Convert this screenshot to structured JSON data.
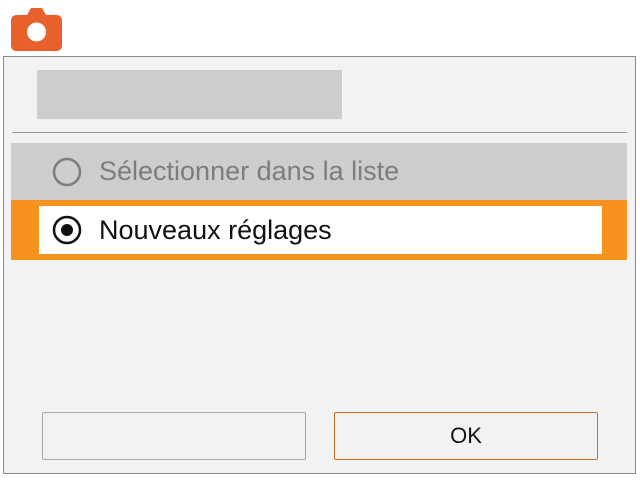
{
  "app": {
    "icon": "camera-icon",
    "accent_color": "#e8602c"
  },
  "dialog": {
    "title": "",
    "options": [
      {
        "label": "Sélectionner dans la liste",
        "selected": false,
        "enabled": false
      },
      {
        "label": "Nouveaux réglages",
        "selected": true,
        "enabled": true
      }
    ],
    "highlight_color": "#f7921e",
    "buttons": {
      "secondary_label": "",
      "ok_label": "OK"
    }
  }
}
